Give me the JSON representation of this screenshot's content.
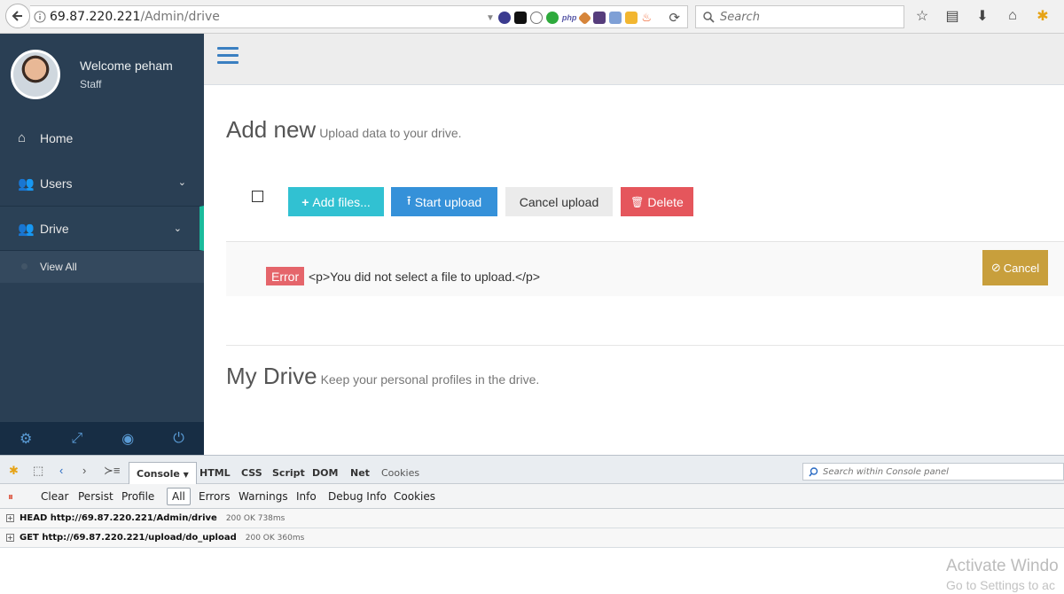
{
  "browser": {
    "url_host": "69.87.220.221",
    "url_path": "/Admin/drive",
    "search_placeholder": "Search"
  },
  "sidebar": {
    "welcome": "Welcome peham",
    "role": "Staff",
    "items": [
      {
        "label": "Home"
      },
      {
        "label": "Users"
      },
      {
        "label": "Drive"
      }
    ],
    "submenu": {
      "label": "View All"
    }
  },
  "main": {
    "add_new": {
      "title": "Add new",
      "subtitle": "Upload data to your drive."
    },
    "buttons": {
      "add_files": "Add files...",
      "start_upload": "Start upload",
      "cancel_upload": "Cancel upload",
      "delete": "Delete"
    },
    "upload_error": {
      "badge": "Error",
      "message": "<p>You did not select a file to upload.</p>",
      "cancel": "Cancel"
    },
    "my_drive": {
      "title": "My Drive",
      "subtitle": "Keep your personal profiles in the drive."
    }
  },
  "firebug": {
    "tabs": {
      "console": "Console",
      "html": "HTML",
      "css": "CSS",
      "script": "Script",
      "dom": "DOM",
      "net": "Net",
      "cookies": "Cookies"
    },
    "search_placeholder": "Search within Console panel",
    "toolbar": {
      "clear": "Clear",
      "persist": "Persist",
      "profile": "Profile",
      "all": "All",
      "errors": "Errors",
      "warnings": "Warnings",
      "info": "Info",
      "debug_info": "Debug Info",
      "cookies": "Cookies"
    },
    "logs": [
      {
        "request": "HEAD http://69.87.220.221/Admin/drive",
        "status": "200 OK 738ms"
      },
      {
        "request": "GET http://69.87.220.221/upload/do_upload",
        "status": "200 OK 360ms"
      }
    ]
  },
  "watermark": {
    "line1": "Activate Windo",
    "line2": "Go to Settings to ac"
  },
  "colors": {
    "sidebar": "#2a3f54",
    "accent": "#1abb9c",
    "info": "#31c1d2",
    "primary": "#3591d9",
    "danger": "#e5565c",
    "warning": "#c89f3c"
  }
}
